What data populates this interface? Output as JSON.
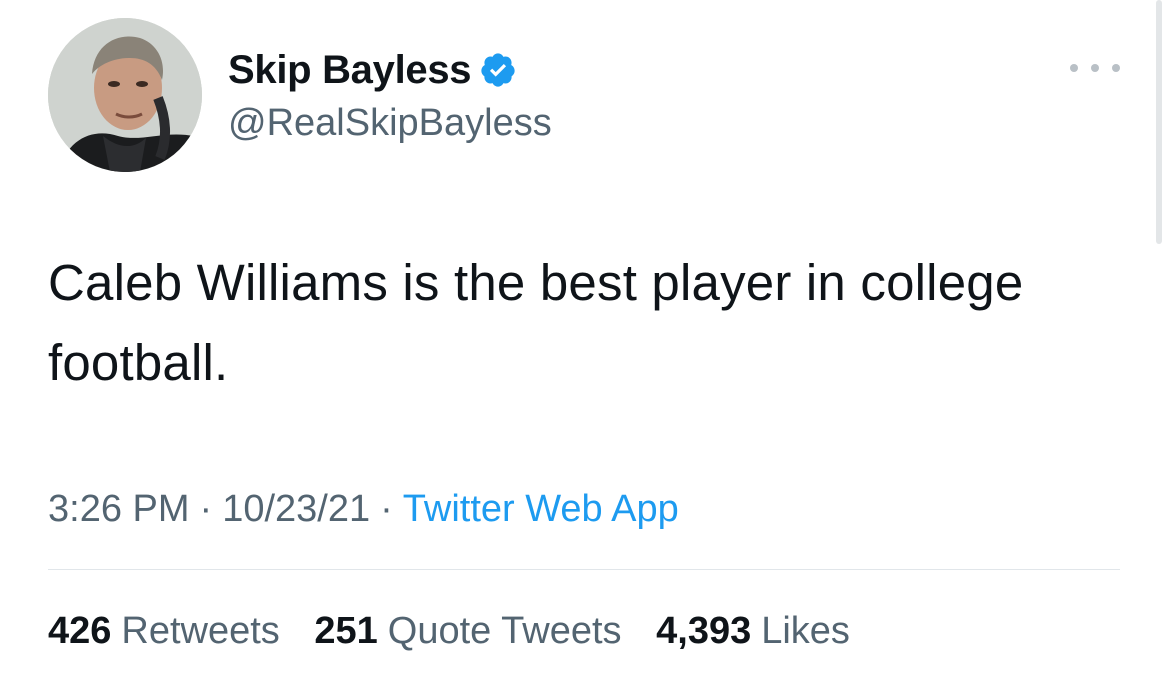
{
  "author": {
    "display_name": "Skip Bayless",
    "handle": "@RealSkipBayless",
    "verified": true,
    "avatar_icon": "profile-photo"
  },
  "tweet": {
    "text": "Caleb Williams is the best player in college football.",
    "time": "3:26 PM",
    "date": "10/23/21",
    "source": "Twitter Web App",
    "separator": "·"
  },
  "stats": {
    "retweets_count": "426",
    "retweets_label": "Retweets",
    "quotes_count": "251",
    "quotes_label": "Quote Tweets",
    "likes_count": "4,393",
    "likes_label": "Likes"
  },
  "colors": {
    "text_primary": "#0f1419",
    "text_secondary": "#536471",
    "accent": "#1d9bf0"
  }
}
